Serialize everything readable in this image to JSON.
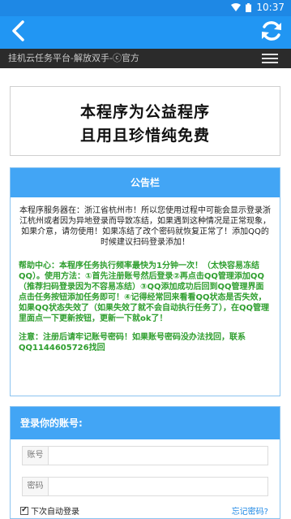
{
  "status": {
    "time": "10:37"
  },
  "header": {
    "subtitle": "挂机云任务平台-解放双手-ⓒ官方"
  },
  "banner": {
    "line1": "本程序为公益程序",
    "line2": "且用且珍惜纯免费"
  },
  "notice": {
    "title": "公告栏",
    "info": "本程序服务器在：浙江省杭州市！所以您使用过程中可能会显示登录浙江杭州或者因为异地登录而导致冻结，如果遇到这种情况是正常现象，如果介意，请勿使用！如果冻结了改个密码就恢复正常了！添加QQ的时候建议扫码登录添加！",
    "help": "帮助中心：本程序任务执行频率最快为1分钟一次！（太快容易冻结QQ）。使用方法：①首先注册账号然后登录②再点击QQ管理添加QQ（推荐扫码登录因为不容易冻结）③QQ添加成功后回到QQ管理界面点击任务按钮添加任务即可！④记得经常回来看看QQ状态是否失效，如果QQ状态失效了（如果失效了就不会自动执行任务了），在QQ管理里面点一下更新按钮，更新一下就ok了！",
    "warning": "注意：注册后请牢记账号密码！如果账号密码没办法找回，联系QQ1144605726找回"
  },
  "login": {
    "title": "登录你的账号:",
    "account_label": "账号",
    "password_label": "密码",
    "remember_label": "下次自动登录",
    "remember_checked": true,
    "forgot_label": "忘记密码?"
  },
  "colors": {
    "primary": "#2196f3",
    "status": "#1e88e5",
    "dark": "#2b2b2b",
    "green": "#2e9e2e"
  }
}
